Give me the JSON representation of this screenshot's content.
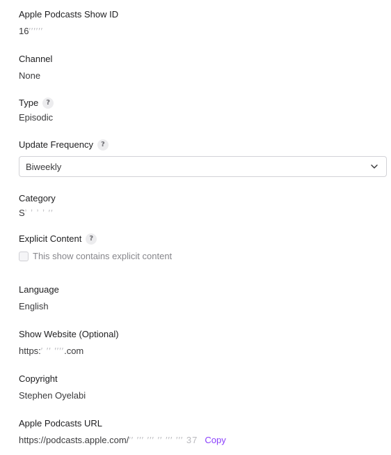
{
  "fields": {
    "show_id": {
      "label": "Apple Podcasts Show ID",
      "value_visible": "16",
      "value_masked": "′′′′′′"
    },
    "channel": {
      "label": "Channel",
      "value": "None"
    },
    "type": {
      "label": "Type",
      "value": "Episodic"
    },
    "update_frequency": {
      "label": "Update Frequency",
      "selected": "Biweekly"
    },
    "category": {
      "label": "Category",
      "value_visible": "S",
      "value_masked": "ʼ ʼ ʼ ʼ ′′"
    },
    "explicit": {
      "label": "Explicit Content",
      "checkbox_label": "This show contains explicit content",
      "checked": false
    },
    "language": {
      "label": "Language",
      "value": "English"
    },
    "website": {
      "label": "Show Website (Optional)",
      "value_start": "https:",
      "value_masked": "′ ′′ ′′′′",
      "value_end": ".com"
    },
    "copyright": {
      "label": "Copyright",
      "value": "Stephen Oyelabi"
    },
    "apple_url": {
      "label": "Apple Podcasts URL",
      "value_start": "https://podcasts.apple.com/",
      "value_masked": "′′ ′′′ ′′′ ′′ ′′′ ′′′ 37",
      "copy_label": "Copy"
    }
  },
  "help_icon_glyph": "?",
  "icons": {
    "help": "question-circle-icon",
    "dropdown": "chevron-down-icon"
  },
  "colors": {
    "accent": "#8a3ffc",
    "text": "#1d1d1f",
    "muted": "#86868b"
  }
}
